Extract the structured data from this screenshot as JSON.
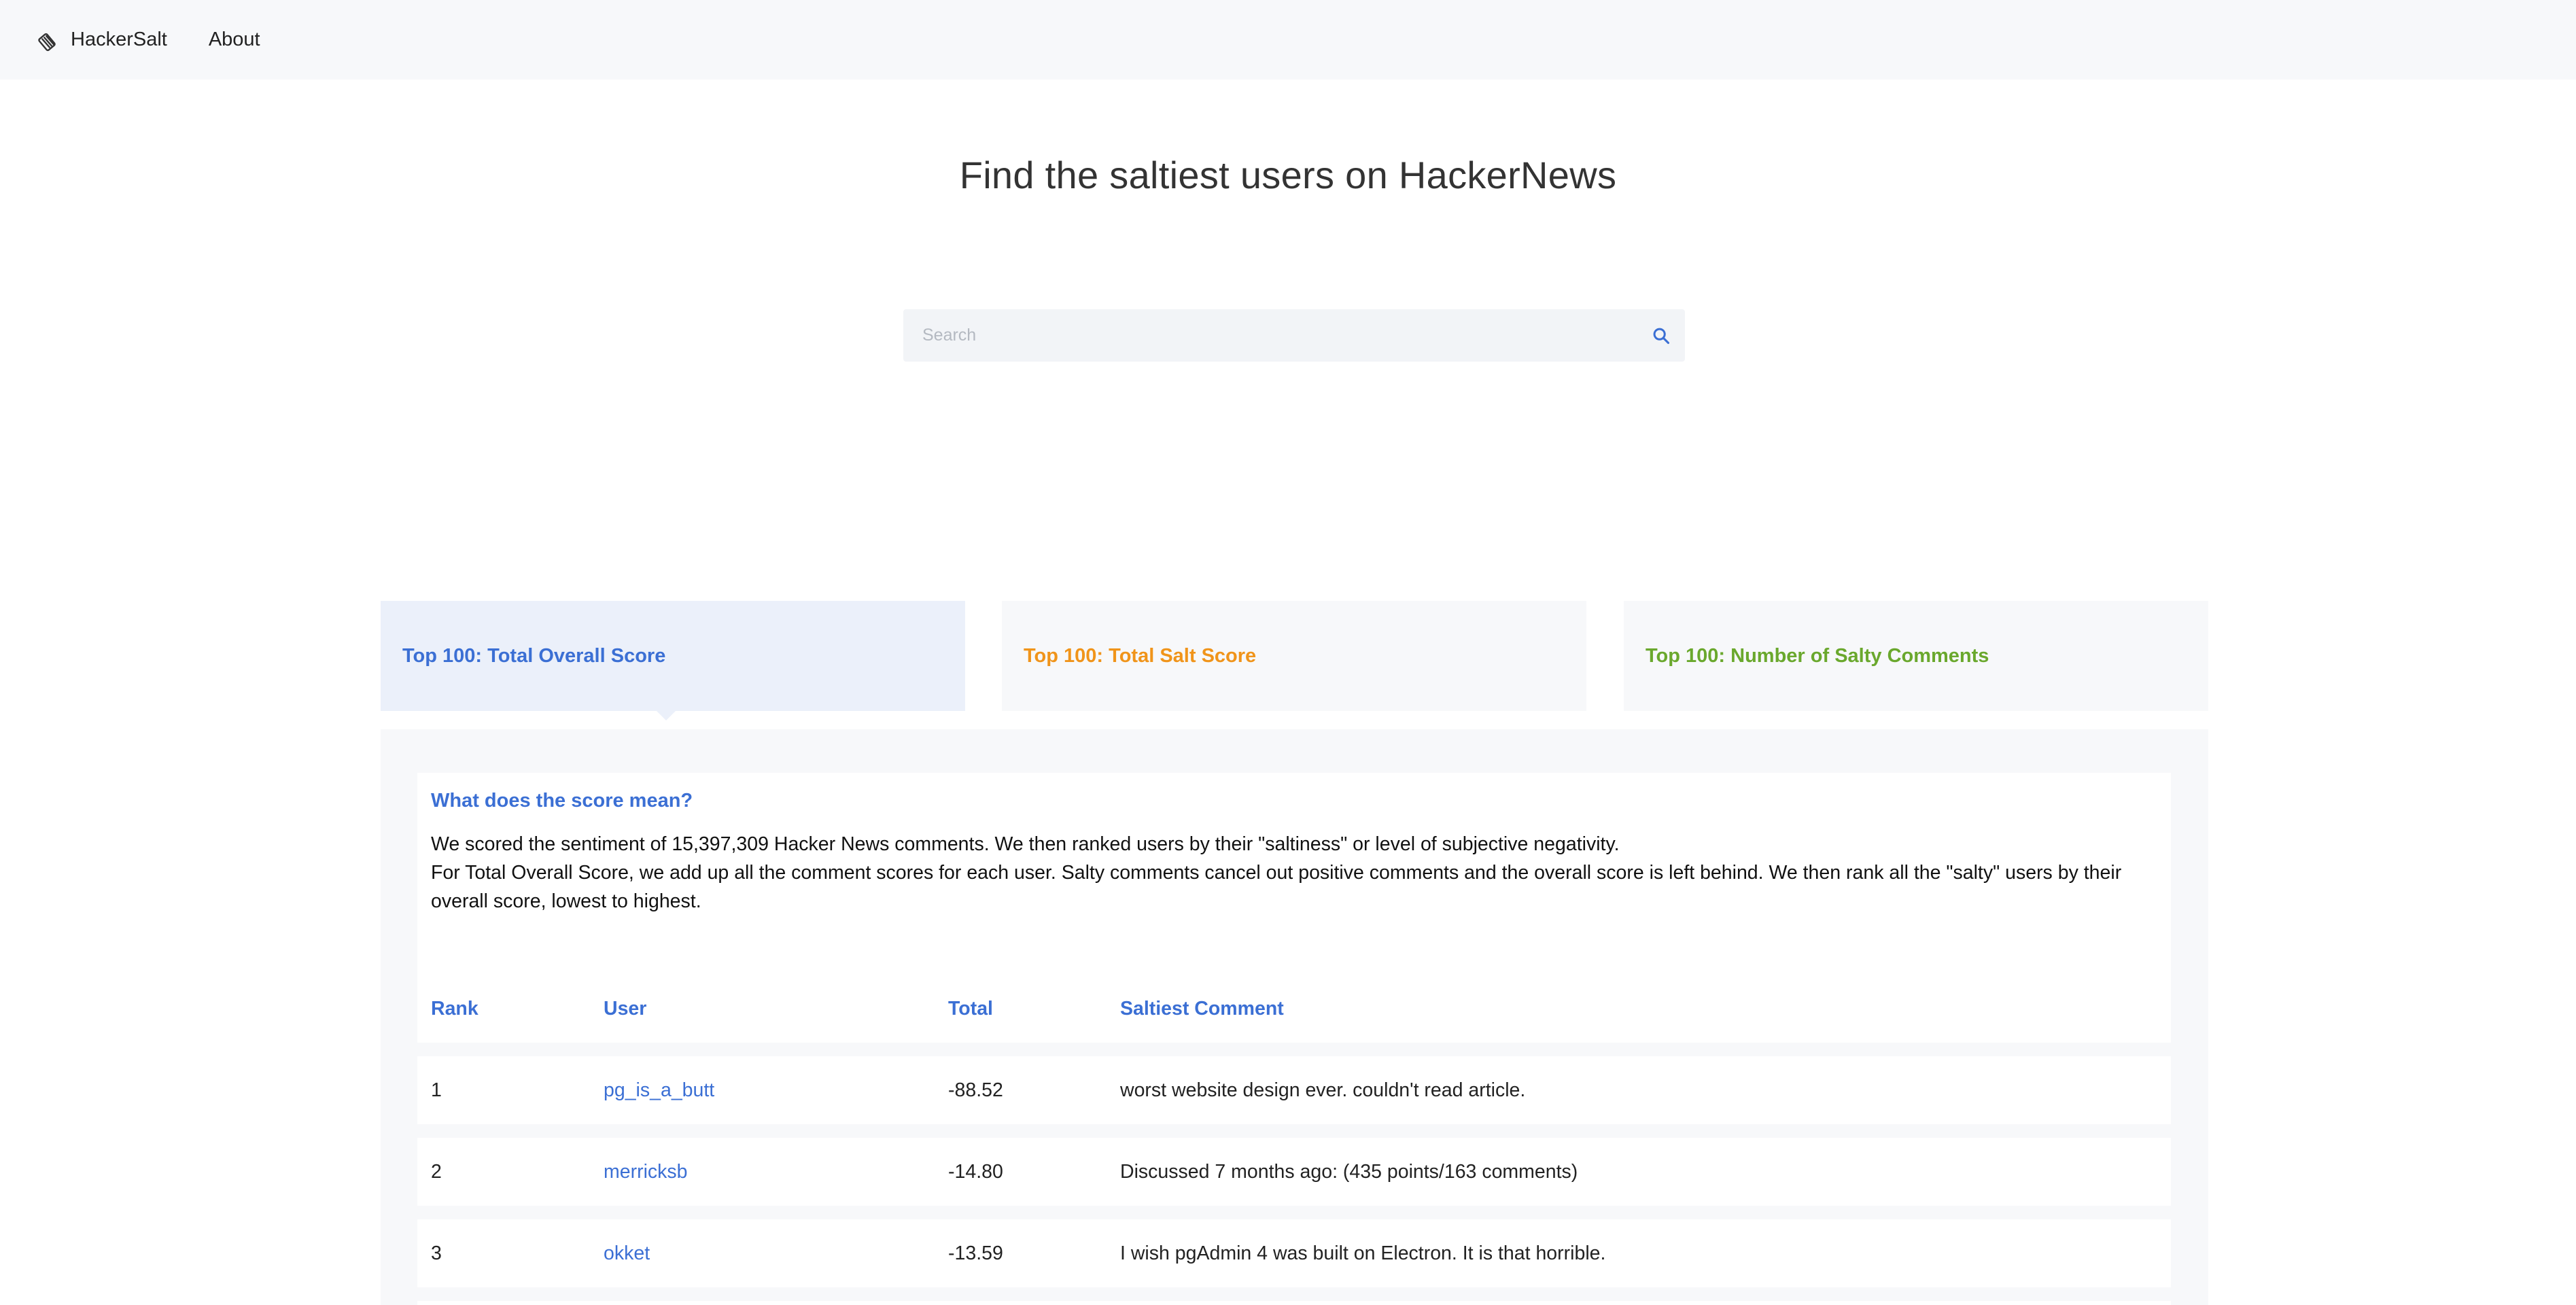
{
  "colors": {
    "accent": "#3b6fd4",
    "orange": "#f0941a",
    "green": "#6aa82d",
    "navbar_bg": "#f7f8fa",
    "tab_active_bg": "#ebf0fa"
  },
  "navbar": {
    "brand_icon": "salt-shaker-icon",
    "brand": "HackerSalt",
    "about": "About"
  },
  "hero": {
    "title": "Find the saltiest users on HackerNews"
  },
  "search": {
    "placeholder": "Search",
    "value": "",
    "icon": "search-icon"
  },
  "tabs": [
    {
      "label": "Top 100: Total Overall Score",
      "active": true
    },
    {
      "label": "Top 100: Total Salt Score",
      "active": false
    },
    {
      "label": "Top 100: Number of Salty Comments",
      "active": false
    }
  ],
  "info": {
    "heading": "What does the score mean?",
    "line1": "We scored the sentiment of 15,397,309 Hacker News comments. We then ranked users by their \"saltiness\" or level of subjective negativity.",
    "line2": "For Total Overall Score, we add up all the comment scores for each user. Salty comments cancel out positive comments and the overall score is left behind. We then rank all the \"salty\" users by their overall score, lowest to highest."
  },
  "table": {
    "headers": {
      "rank": "Rank",
      "user": "User",
      "total": "Total",
      "comment": "Saltiest Comment"
    },
    "rows": [
      {
        "rank": "1",
        "user": "pg_is_a_butt",
        "total": "-88.52",
        "comment": "worst website design ever. couldn't read article."
      },
      {
        "rank": "2",
        "user": "merricksb",
        "total": "-14.80",
        "comment": "Discussed 7 months ago: (435 points/163 comments)"
      },
      {
        "rank": "3",
        "user": "okket",
        "total": "-13.59",
        "comment": "I wish pgAdmin 4 was built on Electron. It is that horrible."
      }
    ]
  }
}
